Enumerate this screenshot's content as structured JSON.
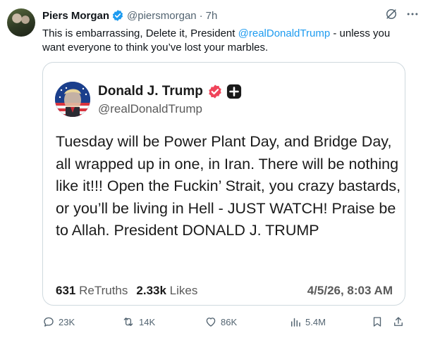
{
  "tweet": {
    "author_name": "Piers Morgan",
    "author_handle": "@piersmorgan",
    "separator": "·",
    "time": "7h",
    "text_before": "This is embarrassing, Delete it, President ",
    "mention": "@realDonaldTrump",
    "text_after": " - unless you want everyone to think you’ve lost your marbles."
  },
  "quoted_post": {
    "author_name": "Donald J. Trump",
    "author_handle": "@realDonaldTrump",
    "body": "Tuesday will be Power Plant Day, and Bridge Day, all wrapped up in one, in Iran. There will be nothing like it!!! Open the Fuckin’ Strait, you crazy bastards, or you’ll be living in Hell - JUST WATCH! Praise be to Allah. President DONALD J. TRUMP",
    "retruths_count": "631",
    "retruths_label": "ReTruths",
    "likes_count": "2.33k",
    "likes_label": "Likes",
    "date": "4/5/26, 8:03 AM"
  },
  "actions": {
    "replies": "23K",
    "reposts": "14K",
    "likes": "86K",
    "views": "5.4M"
  },
  "colors": {
    "accent": "#1d9bf0",
    "text": "#0f1419",
    "secondary": "#536471",
    "truth_badge": "#f0445a"
  },
  "icons": [
    "verified-badge-icon",
    "grok-icon",
    "more-icon",
    "truth-verified-icon",
    "truth-plus-icon",
    "reply-icon",
    "repost-icon",
    "like-icon",
    "views-icon",
    "bookmark-icon",
    "share-icon"
  ]
}
